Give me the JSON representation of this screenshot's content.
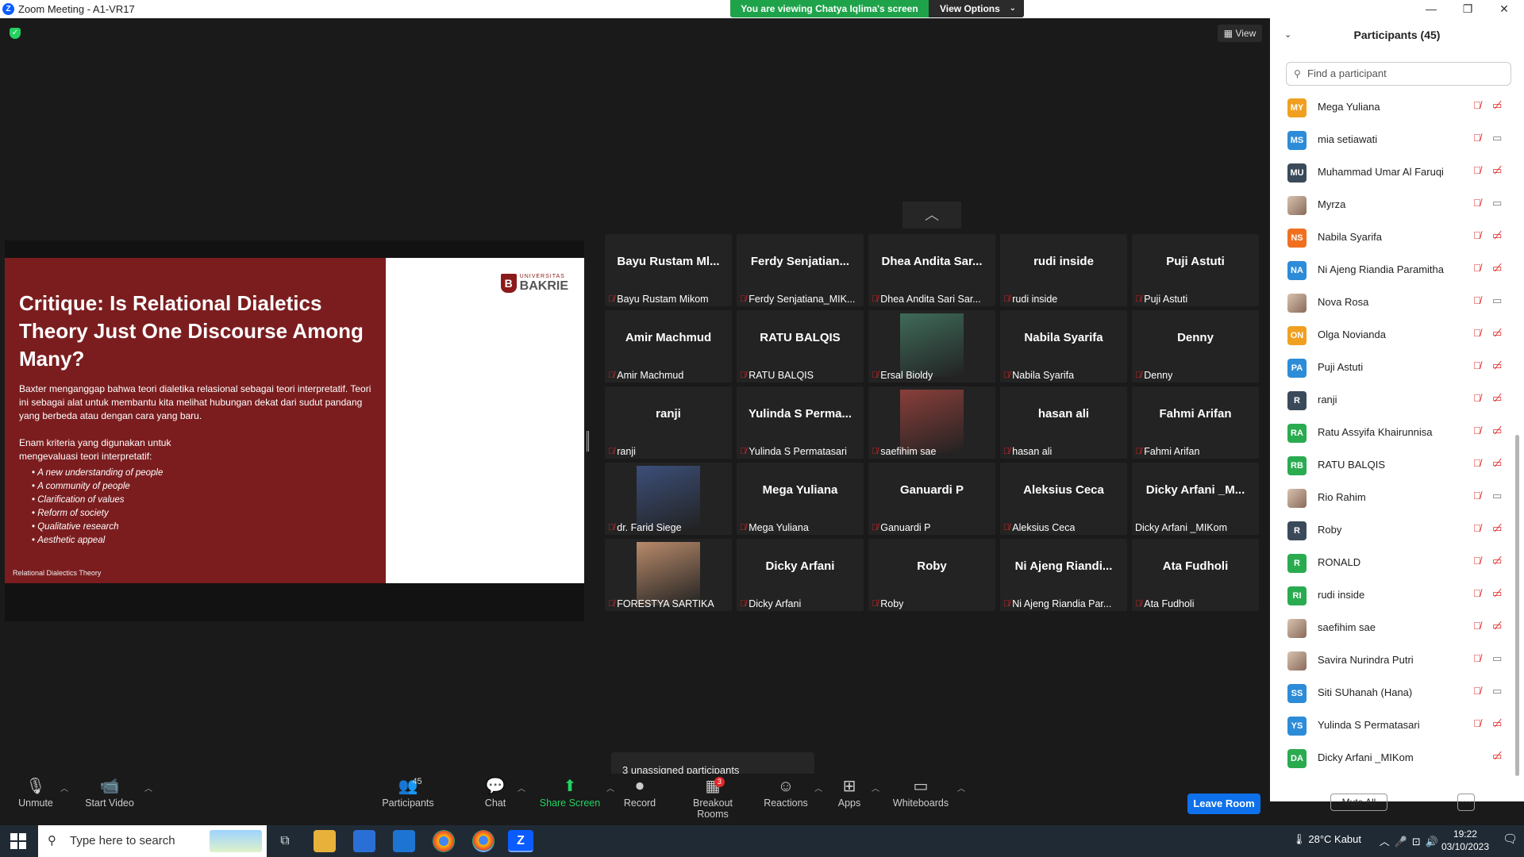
{
  "window": {
    "title": "Zoom Meeting - A1-VR17",
    "logo_letter": "Z",
    "min": "—",
    "max": "❐",
    "close": "✕"
  },
  "banner": {
    "viewing": "You are viewing Chatya Iqlima's screen",
    "view_options": "View Options",
    "chevron": "⌄"
  },
  "main": {
    "view_label": "View",
    "collapse_glyph": "︿",
    "unassigned": "3 unassigned participants"
  },
  "slide": {
    "title": "Critique: Is Relational Dialetics Theory Just One Discourse Among Many?",
    "body": "Baxter menganggap bahwa teori dialetika relasional sebagai teori interpretatif. Teori ini sebagai alat untuk membantu kita melihat hubungan dekat dari sudut pandang yang berbeda atau dengan cara yang baru.",
    "body2": "Enam kriteria yang digunakan untuk mengevaluasi teori interpretatif:",
    "bullets": [
      "A new understanding of people",
      "A community of people",
      "Clarification of values",
      "Reform of society",
      "Qualitative research",
      "Aesthetic appeal"
    ],
    "footer": "Relational Dialectics Theory",
    "logo_top": "UNIVERSITAS",
    "logo_name": "BAKRIE",
    "logo_letter": "B"
  },
  "tiles": [
    {
      "big": "Bayu Rustam Ml...",
      "label": "Bayu Rustam Mikom",
      "muted": true,
      "photo": false
    },
    {
      "big": "Ferdy Senjatian...",
      "label": "Ferdy Senjatiana_MIK...",
      "muted": true,
      "photo": false
    },
    {
      "big": "Dhea Andita Sar...",
      "label": "Dhea Andita Sari Sar...",
      "muted": true,
      "photo": false
    },
    {
      "big": "rudi inside",
      "label": "rudi inside",
      "muted": true,
      "photo": false
    },
    {
      "big": "Puji Astuti",
      "label": "Puji Astuti",
      "muted": true,
      "photo": false
    },
    {
      "big": "Amir Machmud",
      "label": "Amir Machmud",
      "muted": true,
      "photo": false
    },
    {
      "big": "RATU BALQIS",
      "label": "RATU BALQIS",
      "muted": true,
      "photo": false
    },
    {
      "big": "",
      "label": "Ersal Bioldy",
      "muted": true,
      "photo": true,
      "photo_color": "#3f6b5a"
    },
    {
      "big": "Nabila Syarifa",
      "label": "Nabila Syarifa",
      "muted": true,
      "photo": false
    },
    {
      "big": "Denny",
      "label": "Denny",
      "muted": true,
      "photo": false
    },
    {
      "big": "ranji",
      "label": "ranji",
      "muted": true,
      "photo": false
    },
    {
      "big": "Yulinda S Perma...",
      "label": "Yulinda S Permatasari",
      "muted": true,
      "photo": false
    },
    {
      "big": "",
      "label": "saefihim sae",
      "muted": true,
      "photo": true,
      "photo_color": "#8a3f3a"
    },
    {
      "big": "hasan ali",
      "label": "hasan ali",
      "muted": true,
      "photo": false
    },
    {
      "big": "Fahmi Arifan",
      "label": "Fahmi Arifan",
      "muted": true,
      "photo": false
    },
    {
      "big": "",
      "label": "dr. Farid Siege",
      "muted": true,
      "photo": true,
      "photo_color": "#3c4f7a"
    },
    {
      "big": "Mega Yuliana",
      "label": "Mega Yuliana",
      "muted": true,
      "photo": false
    },
    {
      "big": "Ganuardi P",
      "label": "Ganuardi P",
      "muted": true,
      "photo": false
    },
    {
      "big": "Aleksius Ceca",
      "label": "Aleksius Ceca",
      "muted": true,
      "photo": false
    },
    {
      "big": "Dicky Arfani _M...",
      "label": "Dicky Arfani _MIKom",
      "muted": false,
      "photo": false
    },
    {
      "big": "",
      "label": "FORESTYA SARTIKA",
      "muted": true,
      "photo": true,
      "photo_color": "#b88a6a"
    },
    {
      "big": "Dicky Arfani",
      "label": "Dicky Arfani",
      "muted": true,
      "photo": false
    },
    {
      "big": "Roby",
      "label": "Roby",
      "muted": true,
      "photo": false
    },
    {
      "big": "Ni Ajeng Riandi...",
      "label": "Ni Ajeng Riandia Par...",
      "muted": true,
      "photo": false
    },
    {
      "big": "Ata Fudholi",
      "label": "Ata Fudholi",
      "muted": true,
      "photo": false
    }
  ],
  "toolbar": [
    {
      "label": "Unmute",
      "icon": "🎙",
      "arrow": true,
      "name": "unmute-button"
    },
    {
      "label": "Start Video",
      "icon": "📹",
      "arrow": true,
      "name": "start-video-button"
    },
    {
      "label": "Participants",
      "icon": "👥",
      "badge": "45",
      "name": "participants-button"
    },
    {
      "label": "Chat",
      "icon": "💬",
      "arrow": true,
      "name": "chat-button"
    },
    {
      "label": "Share Screen",
      "icon": "⬆",
      "arrow": true,
      "name": "share-screen-button",
      "green": true
    },
    {
      "label": "Record",
      "icon": "⏺",
      "name": "record-button"
    },
    {
      "label": "Breakout Rooms",
      "icon": "▦",
      "badge": "3",
      "name": "breakout-rooms-button"
    },
    {
      "label": "Reactions",
      "icon": "☺",
      "arrow": true,
      "name": "reactions-button"
    },
    {
      "label": "Apps",
      "icon": "⊞",
      "arrow": true,
      "name": "apps-button"
    },
    {
      "label": "Whiteboards",
      "icon": "▭",
      "arrow": true,
      "name": "whiteboards-button"
    }
  ],
  "leave": "Leave Room",
  "panel": {
    "title": "Participants (45)",
    "find_placeholder": "Find a participant",
    "mute_all": "Mute All",
    "more": "···",
    "participants": [
      {
        "initials": "MY",
        "name": "Mega Yuliana",
        "color": "#f0a020",
        "video": false
      },
      {
        "initials": "MS",
        "name": "mia setiawati",
        "color": "#2d8cd8",
        "video": true
      },
      {
        "initials": "MU",
        "name": "Muhammad Umar Al Faruqi",
        "color": "#3a4a5a",
        "video": false
      },
      {
        "initials": "",
        "name": "Myrza",
        "color": "#c8a090",
        "photo": true,
        "video": true
      },
      {
        "initials": "NS",
        "name": "Nabila Syarifa",
        "color": "#f07020",
        "video": false
      },
      {
        "initials": "NA",
        "name": "Ni Ajeng Riandia Paramitha",
        "color": "#2d8cd8",
        "video": false
      },
      {
        "initials": "",
        "name": "Nova Rosa",
        "color": "#a05050",
        "photo": true,
        "video": true
      },
      {
        "initials": "ON",
        "name": "Olga Novianda",
        "color": "#f0a020",
        "video": false
      },
      {
        "initials": "PA",
        "name": "Puji Astuti",
        "color": "#2d8cd8",
        "video": false
      },
      {
        "initials": "R",
        "name": "ranji",
        "color": "#3a4a5a",
        "video": false
      },
      {
        "initials": "RA",
        "name": "Ratu Assyifa Khairunnisa",
        "color": "#2aab50",
        "video": false
      },
      {
        "initials": "RB",
        "name": "RATU BALQIS",
        "color": "#2aab50",
        "video": false
      },
      {
        "initials": "",
        "name": "Rio Rahim",
        "color": "#7080a0",
        "photo": true,
        "video": true
      },
      {
        "initials": "R",
        "name": "Roby",
        "color": "#3a4a5a",
        "video": false
      },
      {
        "initials": "R",
        "name": "RONALD",
        "color": "#2aab50",
        "video": false
      },
      {
        "initials": "RI",
        "name": "rudi inside",
        "color": "#2aab50",
        "video": false
      },
      {
        "initials": "",
        "name": "saefihim sae",
        "color": "#c04040",
        "photo": true,
        "video": false
      },
      {
        "initials": "",
        "name": "Savira Nurindra Putri",
        "color": "#e0c0a0",
        "photo": true,
        "video": true
      },
      {
        "initials": "SS",
        "name": "Siti SUhanah (Hana)",
        "color": "#2d8cd8",
        "video": true
      },
      {
        "initials": "YS",
        "name": "Yulinda S Permatasari",
        "color": "#2d8cd8",
        "video": false
      },
      {
        "initials": "DA",
        "name": "Dicky Arfani _MIKom",
        "color": "#2aab50",
        "video": false,
        "nomic": true
      }
    ]
  },
  "taskbar": {
    "search_placeholder": "Type here to search",
    "weather": "28°C  Kabut",
    "time": "19:22",
    "date": "03/10/2023",
    "notif_count": "1"
  }
}
